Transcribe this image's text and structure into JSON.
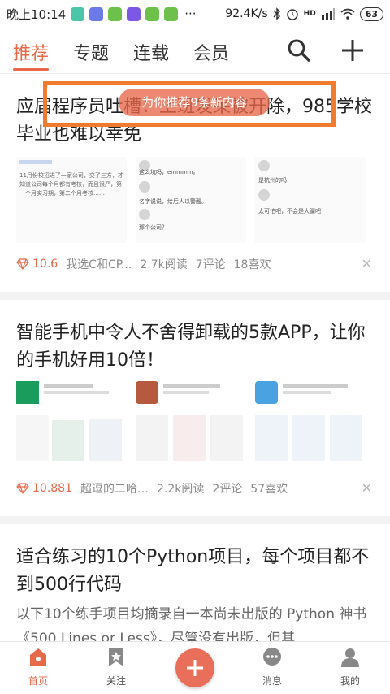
{
  "status_bar": {
    "time": "晚上10:14",
    "dots": "···",
    "speed": "92.4K/s",
    "hd": "HD",
    "battery": "63"
  },
  "top_nav": {
    "tabs": [
      {
        "label": "推荐",
        "active": true
      },
      {
        "label": "专题",
        "active": false
      },
      {
        "label": "连载",
        "active": false
      },
      {
        "label": "会员",
        "active": false
      }
    ],
    "icons": [
      "search-icon",
      "plus-icon"
    ]
  },
  "toast": {
    "text": "为你推荐9条新内容"
  },
  "articles": [
    {
      "title": "应届程序员吐槽：上班发呆被开除，985学校毕业也难以幸免",
      "score": "10.6",
      "author": "我选C和CP...",
      "reads": "2.7k阅读",
      "comments": "7评论",
      "likes": "18喜欢",
      "thumb_texts": [
        "11月份校招进了一家公司，交了三方，才知道公司每个月都有考核，而且很严，第一个月实习期，第二个月考核……",
        "这么坑吗，emmmm。",
        "名字说说，给后人以警醒。",
        "那个公司？",
        "是杭州的吗",
        "太可怕吧，不会是大疆吧"
      ]
    },
    {
      "title": "智能手机中令人不舍得卸载的5款APP，让你的手机好用10倍！",
      "score": "10.881",
      "author": "超逗的二哈少...",
      "reads": "2.2k阅读",
      "comments": "2评论",
      "likes": "57喜欢"
    },
    {
      "title": "适合练习的10个Python项目，每个项目都不到500行代码",
      "excerpt": "以下10个练手项目均摘录自一本尚未出版的 Python 神书《500 Lines or Less》，尽管没有出版，但其"
    }
  ],
  "bottom_nav": {
    "items": [
      {
        "label": "首页",
        "icon": "home-icon",
        "active": true
      },
      {
        "label": "关注",
        "icon": "star-icon",
        "active": false
      },
      {
        "label": "",
        "icon": "plus-icon",
        "active": false
      },
      {
        "label": "消息",
        "icon": "message-icon",
        "active": false
      },
      {
        "label": "我的",
        "icon": "user-icon",
        "active": false
      }
    ]
  },
  "colors": {
    "accent": "#e8684a",
    "highlight_box": "#f07a2d"
  }
}
